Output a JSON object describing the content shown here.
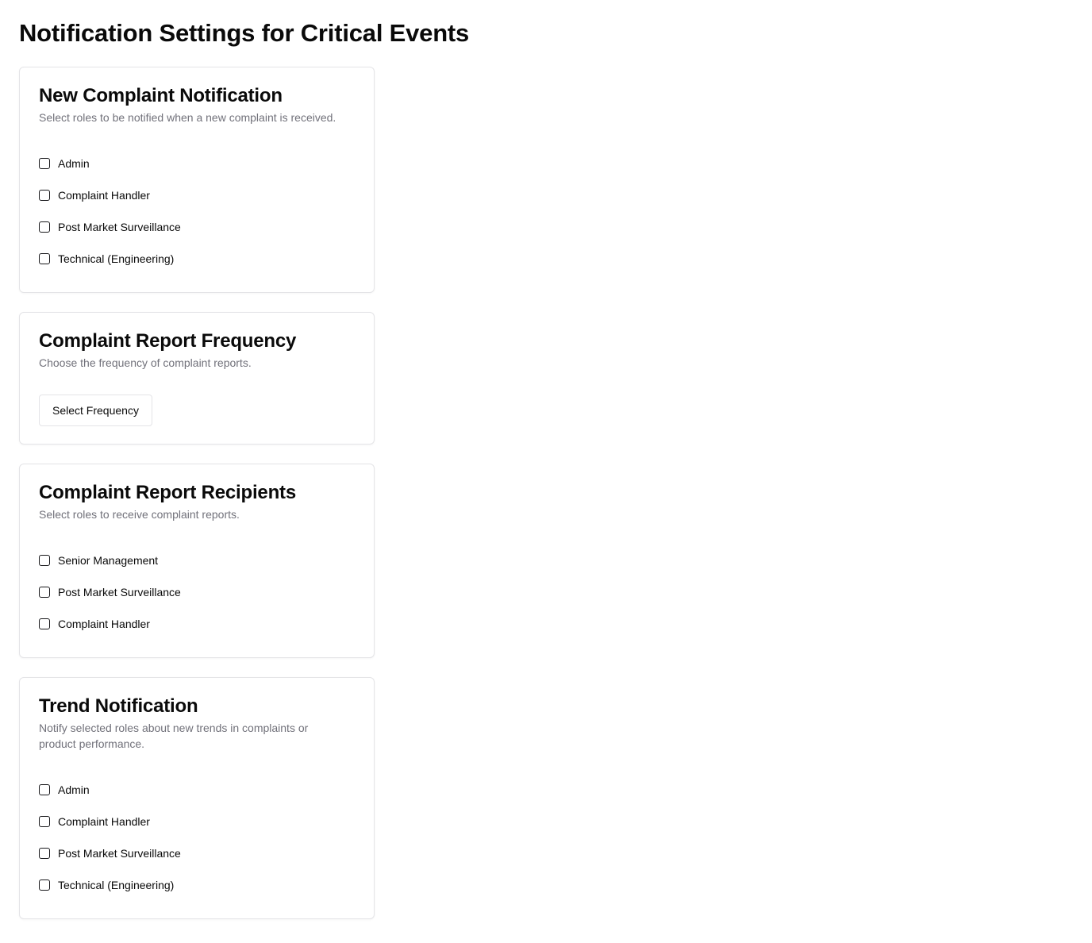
{
  "page": {
    "title": "Notification Settings for Critical Events"
  },
  "cards": [
    {
      "title": "New Complaint Notification",
      "description": "Select roles to be notified when a new complaint is received.",
      "options": [
        "Admin",
        "Complaint Handler",
        "Post Market Surveillance",
        "Technical (Engineering)"
      ]
    },
    {
      "title": "Complaint Report Frequency",
      "description": "Choose the frequency of complaint reports.",
      "select_label": "Select Frequency"
    },
    {
      "title": "Complaint Report Recipients",
      "description": "Select roles to receive complaint reports.",
      "options": [
        "Senior Management",
        "Post Market Surveillance",
        "Complaint Handler"
      ]
    },
    {
      "title": "Trend Notification",
      "description": "Notify selected roles about new trends in complaints or product performance.",
      "options": [
        "Admin",
        "Complaint Handler",
        "Post Market Surveillance",
        "Technical (Engineering)"
      ]
    }
  ],
  "colors": {
    "border": "#e4e4e7",
    "muted_text": "#71717a",
    "text": "#0a0a0a",
    "checkbox_border": "#18181b"
  }
}
